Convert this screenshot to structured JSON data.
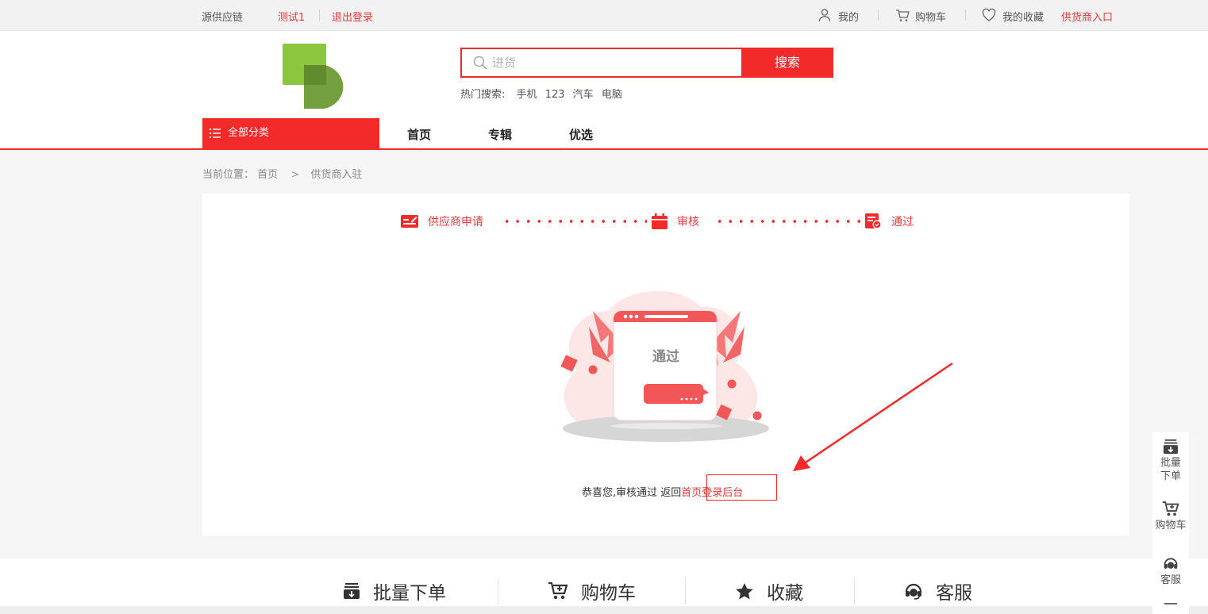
{
  "topbar": {
    "brand": "源供应链",
    "user": "测试1",
    "logout": "退出登录",
    "my": "我的",
    "cart": "购物车",
    "favorites": "我的收藏",
    "supplier_entry": "供货商入口"
  },
  "search": {
    "placeholder": "进货",
    "button": "搜索",
    "hot_label": "热门搜索:",
    "hot_terms": [
      "手机",
      "123",
      "汽车",
      "电脑"
    ]
  },
  "nav": {
    "all_categories": "全部分类",
    "items": [
      "首页",
      "专辑",
      "优选"
    ]
  },
  "breadcrumb": {
    "label": "当前位置：",
    "home": "首页",
    "current": "供货商入驻"
  },
  "steps": [
    "供应商申请",
    "审核",
    "通过"
  ],
  "illustration": {
    "card_text": "通过"
  },
  "result": {
    "message": "恭喜您,审核通过 返回",
    "home_link": "首页",
    "admin_link": "登录后台"
  },
  "footer": {
    "items": [
      {
        "label": "批量下单",
        "icon": "batch-order-icon"
      },
      {
        "label": "购物车",
        "icon": "cart-add-icon"
      },
      {
        "label": "收藏",
        "icon": "star-icon"
      },
      {
        "label": "客服",
        "icon": "headset-icon"
      }
    ]
  },
  "sidebar_float": {
    "batch_order_line1": "批量",
    "batch_order_line2": "下单",
    "cart": "购物车",
    "service": "客服"
  },
  "colors": {
    "accent": "#f22a2a",
    "link": "#e4393c"
  }
}
